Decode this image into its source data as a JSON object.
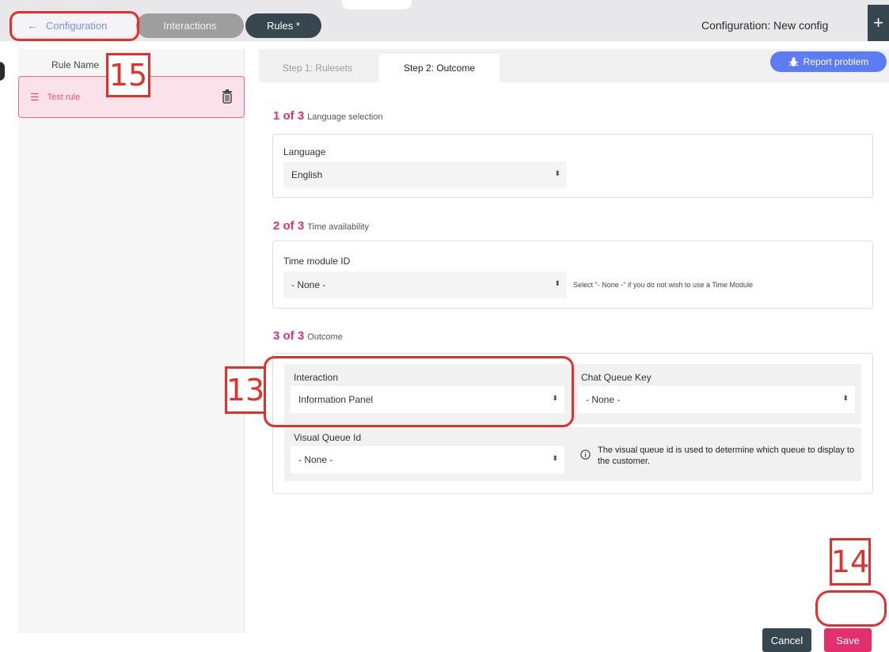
{
  "topbar": {
    "back_label": "Configuration",
    "tabs": [
      {
        "label": "Interactions"
      },
      {
        "label": "Rules *"
      }
    ],
    "config_title": "Configuration: New config",
    "plus_label": "+"
  },
  "sidebar": {
    "header": "Rule Name",
    "rules": [
      {
        "name": "Test rule"
      }
    ]
  },
  "main": {
    "steps": [
      {
        "label": "Step 1: Rulesets"
      },
      {
        "label": "Step 2: Outcome"
      }
    ],
    "report_label": "Report problem",
    "sections": [
      {
        "count": "1 of 3",
        "title": "Language selection",
        "field_label": "Language",
        "value": "English"
      },
      {
        "count": "2 of 3",
        "title": "Time availability",
        "field_label": "Time module ID",
        "value": "- None -",
        "hint": "Select \"- None -\" if you do not wish to use a Time Module"
      },
      {
        "count": "3 of 3",
        "title": "Outcome",
        "interaction_label": "Interaction",
        "interaction_value": "Information Panel",
        "chat_label": "Chat Queue Key",
        "chat_value": "- None -",
        "visual_label": "Visual Queue Id",
        "visual_value": "- None -",
        "visual_info": "The visual queue id is used to determine which queue to display to the customer."
      }
    ],
    "cancel_label": "Cancel",
    "save_label": "Save"
  },
  "annotations": {
    "n13": "13",
    "n14": "14",
    "n15": "15"
  },
  "colors": {
    "accent": "#e3306c",
    "dark": "#37474f",
    "link": "#7b8ef0",
    "report": "#5b7cf5",
    "annotation": "#e2312d"
  },
  "icons": [
    "arrow-left-icon",
    "drag-handle-icon",
    "trash-icon",
    "bug-icon",
    "info-icon",
    "caret-updown-icon",
    "plus-icon"
  ]
}
